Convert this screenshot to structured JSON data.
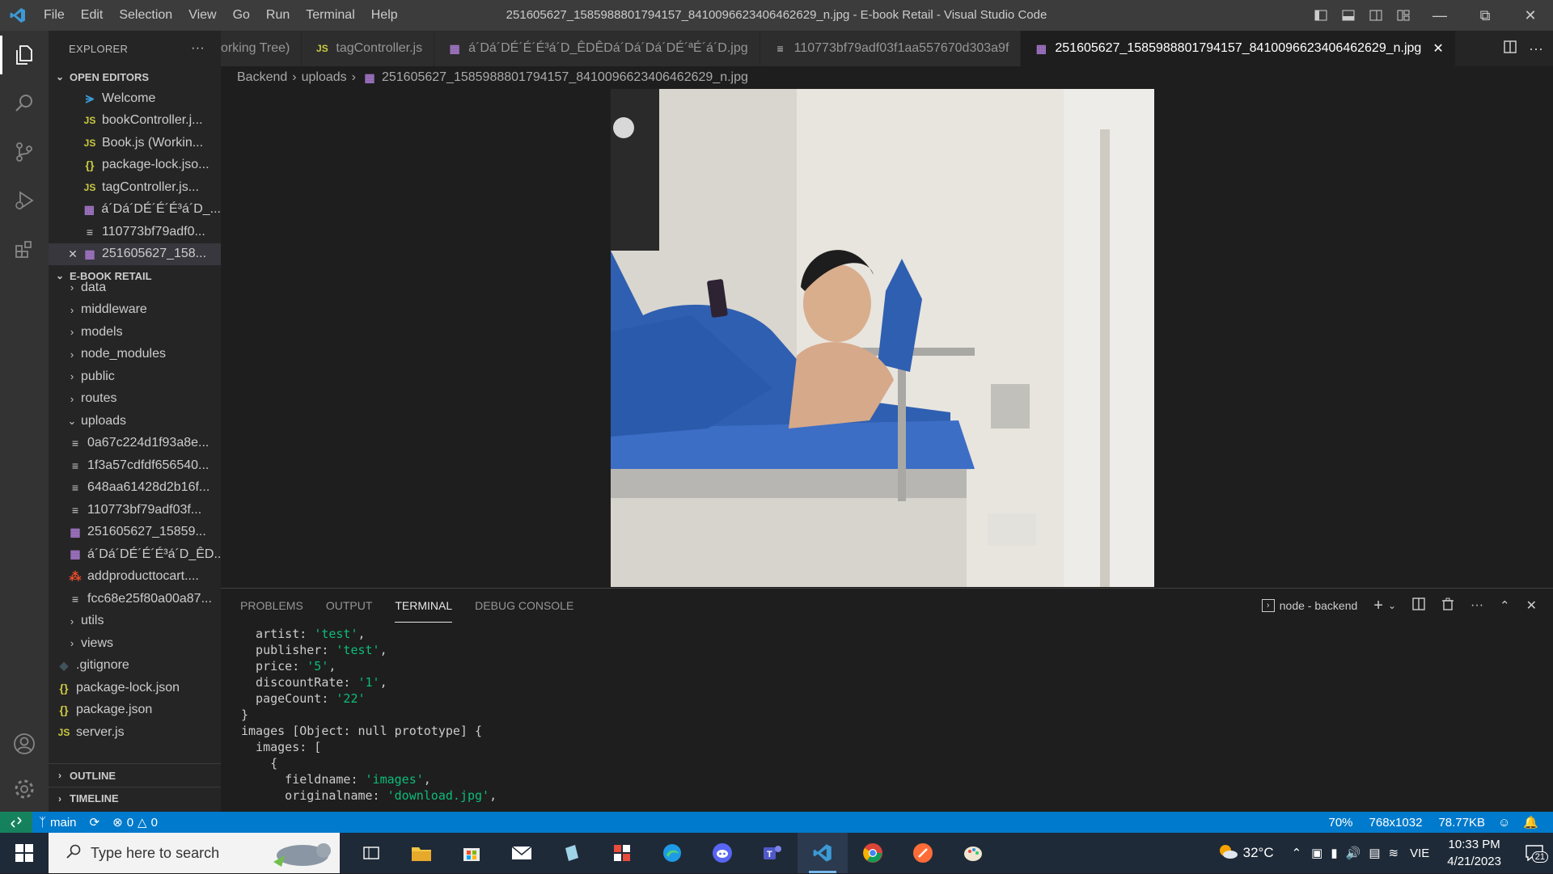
{
  "titlebar": {
    "menu": [
      "File",
      "Edit",
      "Selection",
      "View",
      "Go",
      "Run",
      "Terminal",
      "Help"
    ],
    "title": "251605627_1585988801794157_8410096623406462629_n.jpg - E-book Retail - Visual Studio Code"
  },
  "sidebar": {
    "header": "EXPLORER",
    "open_editors_label": "OPEN EDITORS",
    "open_editors": [
      {
        "label": "Welcome",
        "icon": "vscode-icon"
      },
      {
        "label": "bookController.j...",
        "icon": "js"
      },
      {
        "label": "Book.js (Workin...",
        "icon": "js"
      },
      {
        "label": "package-lock.jso...",
        "icon": "json"
      },
      {
        "label": "tagController.js...",
        "icon": "js"
      },
      {
        "label": "á´Dá´DÉ´É´É³á´D_...",
        "icon": "image"
      },
      {
        "label": "110773bf79adf0...",
        "icon": "text"
      },
      {
        "label": "251605627_158...",
        "icon": "image"
      }
    ],
    "project_label": "E-BOOK RETAIL",
    "tree": [
      {
        "label": "data",
        "type": "folder"
      },
      {
        "label": "middleware",
        "type": "folder"
      },
      {
        "label": "models",
        "type": "folder"
      },
      {
        "label": "node_modules",
        "type": "folder"
      },
      {
        "label": "public",
        "type": "folder"
      },
      {
        "label": "routes",
        "type": "folder"
      },
      {
        "label": "uploads",
        "type": "folder-open"
      }
    ],
    "uploads": [
      {
        "label": "0a67c224d1f93a8e...",
        "icon": "text"
      },
      {
        "label": "1f3a57cdfdf656540...",
        "icon": "text"
      },
      {
        "label": "648aa61428d2b16f...",
        "icon": "text"
      },
      {
        "label": "110773bf79adf03f...",
        "icon": "text"
      },
      {
        "label": "251605627_15859...",
        "icon": "image"
      },
      {
        "label": "á´Dá´DÉ´É´É³á´D_ÊD...",
        "icon": "image"
      },
      {
        "label": "addproducttocart....",
        "icon": "pdf"
      },
      {
        "label": "fcc68e25f80a00a87...",
        "icon": "text"
      }
    ],
    "tree_after": [
      {
        "label": "utils",
        "type": "folder"
      },
      {
        "label": "views",
        "type": "folder"
      },
      {
        "label": ".gitignore",
        "icon": "git"
      },
      {
        "label": "package-lock.json",
        "icon": "json"
      },
      {
        "label": "package.json",
        "icon": "json"
      },
      {
        "label": "server.js",
        "icon": "js"
      }
    ],
    "outline_label": "OUTLINE",
    "timeline_label": "TIMELINE"
  },
  "tabs": [
    {
      "label": "orking Tree)",
      "icon": "",
      "active": false
    },
    {
      "label": "tagController.js",
      "icon": "js",
      "active": false
    },
    {
      "label": "á´Dá´DÉ´É´É³á´D_ÊDÊDá´Dá´Dá´DÉ´ªÉ´á´D.jpg",
      "icon": "image",
      "active": false
    },
    {
      "label": "110773bf79adf03f1aa557670d303a9f",
      "icon": "text",
      "active": false
    },
    {
      "label": "251605627_1585988801794157_8410096623406462629_n.jpg",
      "icon": "image",
      "active": true
    }
  ],
  "breadcrumb": [
    "Backend",
    "uploads",
    "251605627_1585988801794157_8410096623406462629_n.jpg"
  ],
  "panel": {
    "tabs": [
      "PROBLEMS",
      "OUTPUT",
      "TERMINAL",
      "DEBUG CONSOLE"
    ],
    "active_tab": "TERMINAL",
    "terminal_name": "node - backend",
    "lines": [
      {
        "pre": "  artist: ",
        "str": "'test'",
        "post": ","
      },
      {
        "pre": "  publisher: ",
        "str": "'test'",
        "post": ","
      },
      {
        "pre": "  price: ",
        "str": "'5'",
        "post": ","
      },
      {
        "pre": "  discountRate: ",
        "str": "'1'",
        "post": ","
      },
      {
        "pre": "  pageCount: ",
        "str": "'22'",
        "post": ""
      },
      {
        "pre": "}",
        "str": "",
        "post": ""
      },
      {
        "pre": "images [Object: null prototype] {",
        "str": "",
        "post": ""
      },
      {
        "pre": "  images: [",
        "str": "",
        "post": ""
      },
      {
        "pre": "    {",
        "str": "",
        "post": ""
      },
      {
        "pre": "      fieldname: ",
        "str": "'images'",
        "post": ","
      },
      {
        "pre": "      originalname: ",
        "str": "'download.jpg'",
        "post": ","
      }
    ]
  },
  "statusbar": {
    "branch": "main",
    "errors": "0",
    "warnings": "0",
    "zoom": "70%",
    "dimensions": "768x1032",
    "filesize": "78.77KB"
  },
  "taskbar": {
    "search_placeholder": "Type here to search",
    "weather": "32°C",
    "language": "VIE",
    "time": "10:33 PM",
    "date": "4/21/2023",
    "notification_count": "21"
  },
  "colors": {
    "accent": "#007acc",
    "remote": "#16825d",
    "string": "#0dbc79"
  }
}
